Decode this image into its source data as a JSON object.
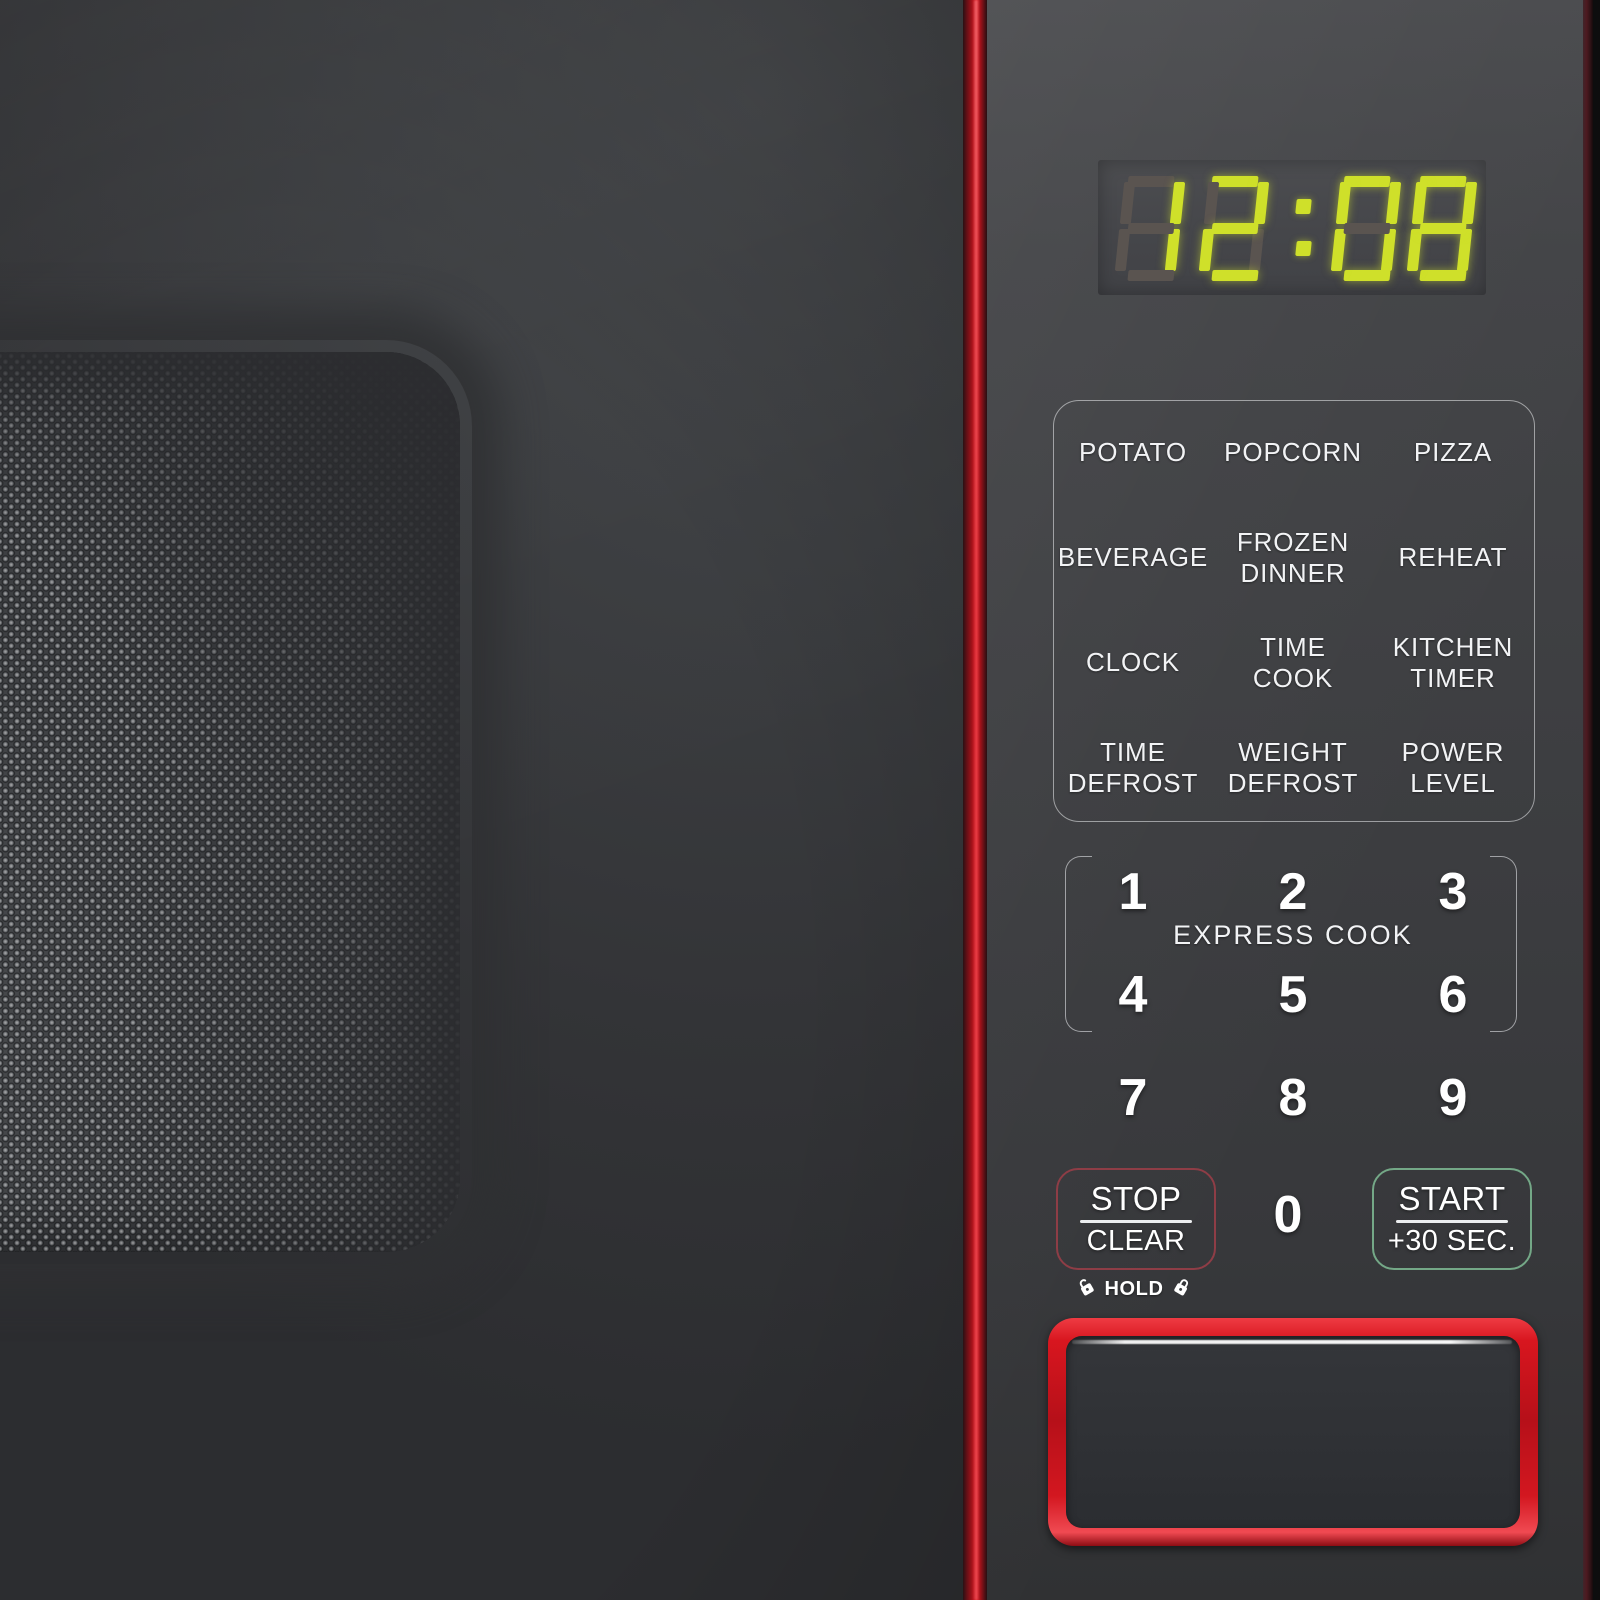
{
  "device": {
    "type": "countertop-microwave-control-panel",
    "colors": {
      "accent_red": "#c5141d",
      "panel_gray": "#3d3e41",
      "door_gray": "#3a3c3f",
      "led_green": "#cfe02a",
      "led_off": "#5a5450",
      "stop_border": "#8e3d46",
      "start_border": "#74a887",
      "label_white": "#f2f3f5"
    }
  },
  "display": {
    "name": "led-clock-display",
    "value": "12:08",
    "digits": [
      "1",
      "2",
      "0",
      "8"
    ],
    "colon": ":",
    "colon_lit": true,
    "segments": {
      "1": [
        "b",
        "c"
      ],
      "2": [
        "a",
        "b",
        "g",
        "e",
        "d"
      ],
      "0": [
        "a",
        "b",
        "c",
        "d",
        "e",
        "f"
      ],
      "8": [
        "a",
        "b",
        "c",
        "d",
        "e",
        "f",
        "g"
      ]
    }
  },
  "menu_pad": {
    "name": "auto-cook-menu-pad",
    "rows": [
      [
        {
          "label": "POTATO",
          "name": "menu-potato"
        },
        {
          "label": "POPCORN",
          "name": "menu-popcorn"
        },
        {
          "label": "PIZZA",
          "name": "menu-pizza"
        }
      ],
      [
        {
          "label": "BEVERAGE",
          "name": "menu-beverage"
        },
        {
          "label": "FROZEN\nDINNER",
          "name": "menu-frozen-dinner"
        },
        {
          "label": "REHEAT",
          "name": "menu-reheat"
        }
      ],
      [
        {
          "label": "CLOCK",
          "name": "menu-clock"
        },
        {
          "label": "TIME\nCOOK",
          "name": "menu-time-cook"
        },
        {
          "label": "KITCHEN\nTIMER",
          "name": "menu-kitchen-timer"
        }
      ],
      [
        {
          "label": "TIME\nDEFROST",
          "name": "menu-time-defrost"
        },
        {
          "label": "WEIGHT\nDEFROST",
          "name": "menu-weight-defrost"
        },
        {
          "label": "POWER\nLEVEL",
          "name": "menu-power-level"
        }
      ]
    ]
  },
  "keypad": {
    "name": "numeric-keypad",
    "keys": [
      "1",
      "2",
      "3",
      "4",
      "5",
      "6",
      "7",
      "8",
      "9"
    ],
    "zero": "0",
    "express_cook_label": "EXPRESS COOK"
  },
  "actions": {
    "stop": {
      "top": "STOP",
      "bottom": "CLEAR",
      "name": "stop-clear-button"
    },
    "start": {
      "top": "START",
      "bottom": "+30 SEC.",
      "name": "start-plus-30-sec-button"
    }
  },
  "child_lock": {
    "label": "HOLD",
    "left_icon": "lock-open-icon",
    "right_icon": "lock-closed-icon"
  },
  "handle": {
    "name": "door-handle-red-trim",
    "color": "#c5141d"
  }
}
